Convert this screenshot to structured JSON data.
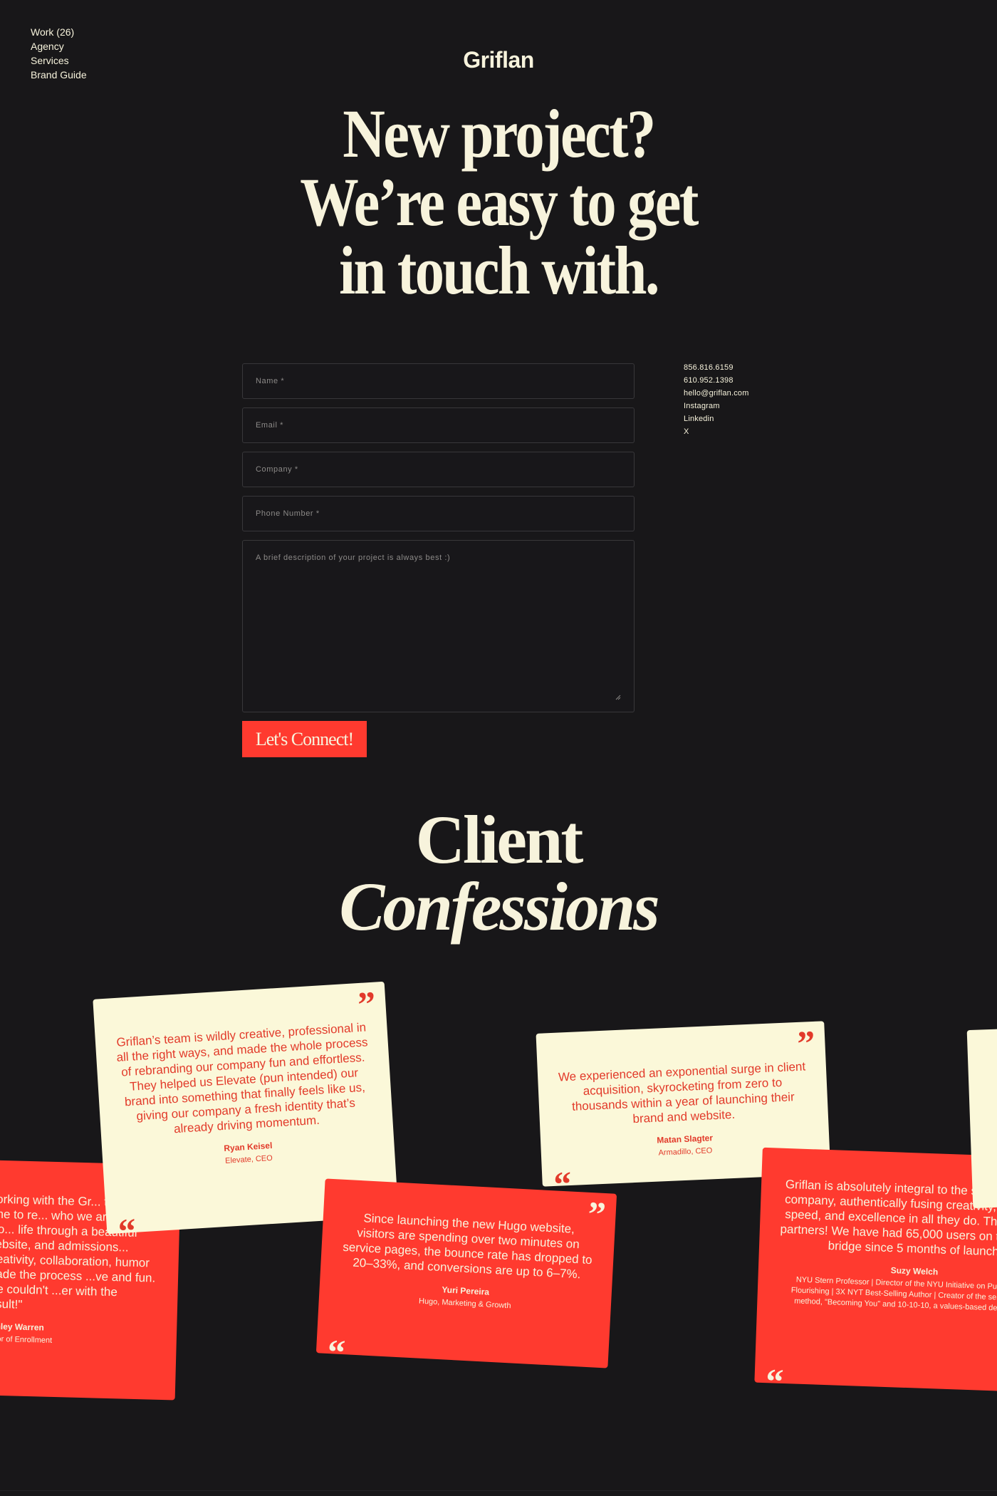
{
  "nav": {
    "items": [
      "Work (26)",
      "Agency",
      "Services",
      "Brand Guide"
    ]
  },
  "brand": {
    "logo": "Griflan"
  },
  "hero": {
    "lines": [
      "New project?",
      "We’re easy to get",
      "in touch with."
    ]
  },
  "form": {
    "name_placeholder": "Name *",
    "email_placeholder": "Email *",
    "company_placeholder": "Company *",
    "phone_placeholder": "Phone Number *",
    "description_placeholder": "A brief description of your project is always best :)",
    "submit_label": "Let's Connect!"
  },
  "contact": {
    "phone1": "856.816.6159",
    "phone2": "610.952.1398",
    "email": "hello@griflan.com",
    "instagram": "Instagram",
    "linkedin": "Linkedin",
    "x": "X"
  },
  "testimonials": {
    "title_line1": "Client",
    "title_line2": "Confessions",
    "quote_mark": "”",
    "items": [
      {
        "quote": "working with the Gr... took the time to re... who we are and bro... life through a beautiful website, and admissions... creativity, collaboration, humor made the process ...ve and fun. We couldn't ...er with the result!\"",
        "name": "Ashley Warren",
        "role": "...ctor of Enrollment"
      },
      {
        "quote": "Griflan’s team is wildly creative, professional in all the right ways, and made the whole process of rebranding our company fun and effortless. They helped us Elevate (pun intended) our brand into something that finally feels like us, giving our company a fresh identity that’s already driving momentum.",
        "name": "Ryan Keisel",
        "role": "Elevate, CEO"
      },
      {
        "quote": "Since launching the new Hugo website, visitors are spending over two minutes on service pages, the bounce rate has dropped to 20–33%, and conversions are up to 6–7%.",
        "name": "Yuri Pereira",
        "role": "Hugo, Marketing & Growth"
      },
      {
        "quote": "We experienced an exponential surge in client acquisition, skyrocketing from zero to thousands within a year of launching their brand and website.",
        "name": "Matan Slagter",
        "role": "Armadillo, CEO"
      },
      {
        "quote": "Griflan is absolutely integral to the success of our company, authentically fusing creativity, empathy, speed, and excellence in all they do. They're true partners! We have had 65,000 users on the values bridge since 5 months of launch.",
        "name": "Suzy Welch",
        "role": "NYU Stern Professor | Director of the NYU Initiative on Purpose and Flourishing | 3X NYT Best-Selling Author | Creator of the self-discovery method, \"Becoming You\" and 10-10-10, a values-based decision tool"
      }
    ]
  },
  "colors": {
    "background": "#181719",
    "cream": "#fbf8d9",
    "accent_red": "#ff3a2f",
    "text_red": "#e23a2a"
  }
}
